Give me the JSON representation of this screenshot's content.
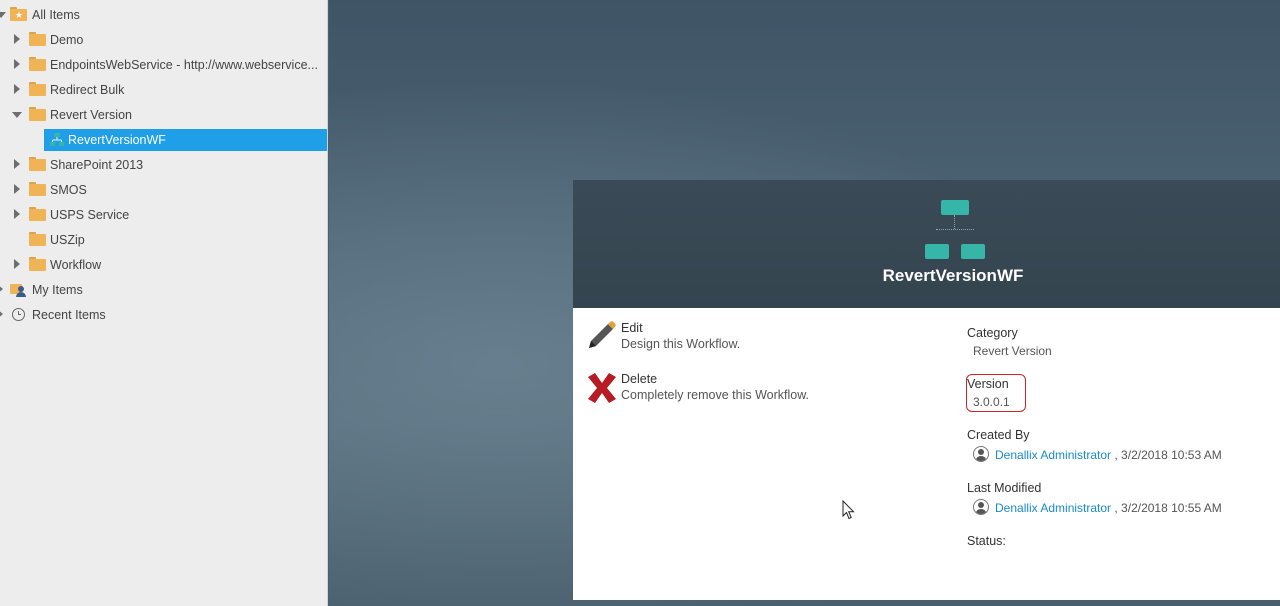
{
  "tree": {
    "all_items": "All Items",
    "folders": [
      {
        "label": "Demo"
      },
      {
        "label": "EndpointsWebService - http://www.webservice..."
      },
      {
        "label": "Redirect Bulk"
      },
      {
        "label": "Revert Version"
      },
      {
        "label": "RevertVersionWF"
      },
      {
        "label": "SharePoint 2013"
      },
      {
        "label": "SMOS"
      },
      {
        "label": "USPS Service"
      },
      {
        "label": "USZip"
      },
      {
        "label": "Workflow"
      }
    ],
    "my_items": "My Items",
    "recent_items": "Recent Items"
  },
  "card": {
    "title": "RevertVersionWF",
    "actions": [
      {
        "title": "Edit",
        "desc": "Design this Workflow.",
        "icon": "pencil-icon"
      },
      {
        "title": "Delete",
        "desc": "Completely remove this Workflow.",
        "icon": "delete-x-icon"
      }
    ],
    "category_label": "Category",
    "category_value": "Revert Version",
    "version_label": "Version",
    "version_value": "3.0.0.1",
    "created_label": "Created By",
    "created_user": "Denallix Administrator",
    "created_date": ", 3/2/2018 10:53 AM",
    "modified_label": "Last Modified",
    "modified_user": "Denallix Administrator",
    "modified_date": ", 3/2/2018 10:55 AM",
    "status_label": "Status:"
  },
  "colors": {
    "accent": "#1f9fe8",
    "workflow_icon": "#35b6a8",
    "header": "#37474f",
    "highlight": "#d0232a"
  }
}
